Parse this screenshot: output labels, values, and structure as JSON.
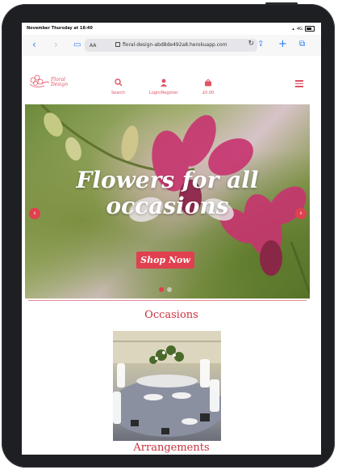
{
  "status": {
    "time": "November Thursday at 18:40",
    "network": "4G"
  },
  "browser": {
    "text_size": "AA",
    "url": "floral-design-abd8de492a8.herokuapp.com"
  },
  "site": {
    "logo_text_line1": "Floral",
    "logo_text_line2": "Design",
    "nav": {
      "search": "Search",
      "account": "Login/Register",
      "cart": "£0.00"
    }
  },
  "hero": {
    "title_line1": "Flowers for all",
    "title_line2": "occasions",
    "cta": "Shop Now",
    "slides": 2,
    "active_slide": 1
  },
  "sections": {
    "occasions": "Occasions",
    "arrangements": "Arrangements"
  },
  "colors": {
    "accent": "#e0404f",
    "text_accent": "#c9333f"
  },
  "icons": {
    "back": "chevron-left-icon",
    "forward": "chevron-right-icon",
    "bookmarks": "book-icon",
    "lock": "lock-icon",
    "reload": "reload-icon",
    "share": "share-icon",
    "new_tab": "plus-icon",
    "tabs": "tabs-icon",
    "search": "search-icon",
    "account": "user-icon",
    "cart": "bag-icon",
    "menu": "hamburger-icon"
  }
}
